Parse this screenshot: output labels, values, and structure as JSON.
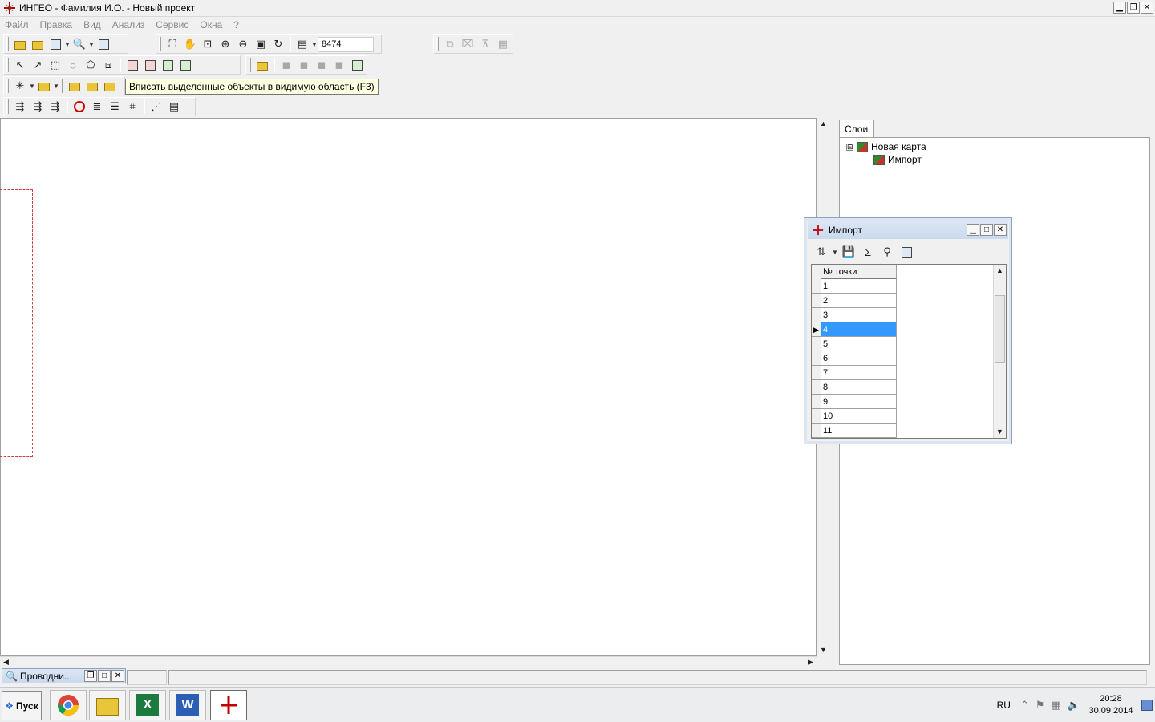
{
  "window": {
    "title": "ИНГЕО - Фамилия И.О. - Новый проект"
  },
  "menu": [
    "Файл",
    "Правка",
    "Вид",
    "Анализ",
    "Сервис",
    "Окна",
    "?"
  ],
  "toolbar": {
    "scale_value": "8474"
  },
  "tooltip": "Вписать выделенные объекты в видимую область (F3)",
  "layers": {
    "tab": "Слои",
    "tree_toggle": "⊟",
    "root": "Новая карта",
    "child": "Импорт"
  },
  "import_window": {
    "title": "Импорт",
    "column_header": "№ точки",
    "rows": [
      "1",
      "2",
      "3",
      "4",
      "5",
      "6",
      "7",
      "8",
      "9",
      "10",
      "11"
    ],
    "selected_row": "4"
  },
  "explorer_min": {
    "title": "Проводни..."
  },
  "taskbar": {
    "start_label": "Пуск",
    "language": "RU",
    "time": "20:28",
    "date": "30.09.2014"
  },
  "colors": {
    "selection": "#3399ff",
    "accent": "#c00000"
  }
}
